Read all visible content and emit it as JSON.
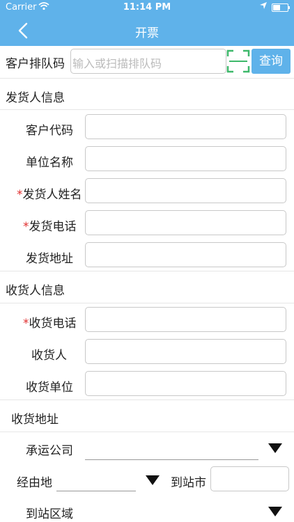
{
  "status_bar": {
    "carrier": "Carrier",
    "time": "11:14 PM"
  },
  "nav": {
    "title": "开票"
  },
  "query": {
    "label": "客户排队码",
    "placeholder": "输入或扫描排队码",
    "button": "查询"
  },
  "sender": {
    "section_title": "发货人信息",
    "fields": [
      {
        "label": "客户代码",
        "required": false,
        "value": ""
      },
      {
        "label": "单位名称",
        "required": false,
        "value": ""
      },
      {
        "label": "发货人姓名",
        "required": true,
        "value": ""
      },
      {
        "label": "发货电话",
        "required": true,
        "value": ""
      },
      {
        "label": "发货地址",
        "required": false,
        "value": ""
      }
    ]
  },
  "receiver": {
    "section_title": "收货人信息",
    "fields": [
      {
        "label": "收货电话",
        "required": true,
        "value": ""
      },
      {
        "label": "收货人",
        "required": false,
        "value": ""
      },
      {
        "label": "收货单位",
        "required": false,
        "value": ""
      }
    ]
  },
  "address": {
    "section_title": "收货地址",
    "carrier_label": "承运公司",
    "via_label": "经由地",
    "city_label": "到站市",
    "area_label": "到站区域"
  },
  "required_mark": "*",
  "colors": {
    "accent": "#5fb2ea",
    "required": "#e03030",
    "scan": "#3db86a"
  }
}
